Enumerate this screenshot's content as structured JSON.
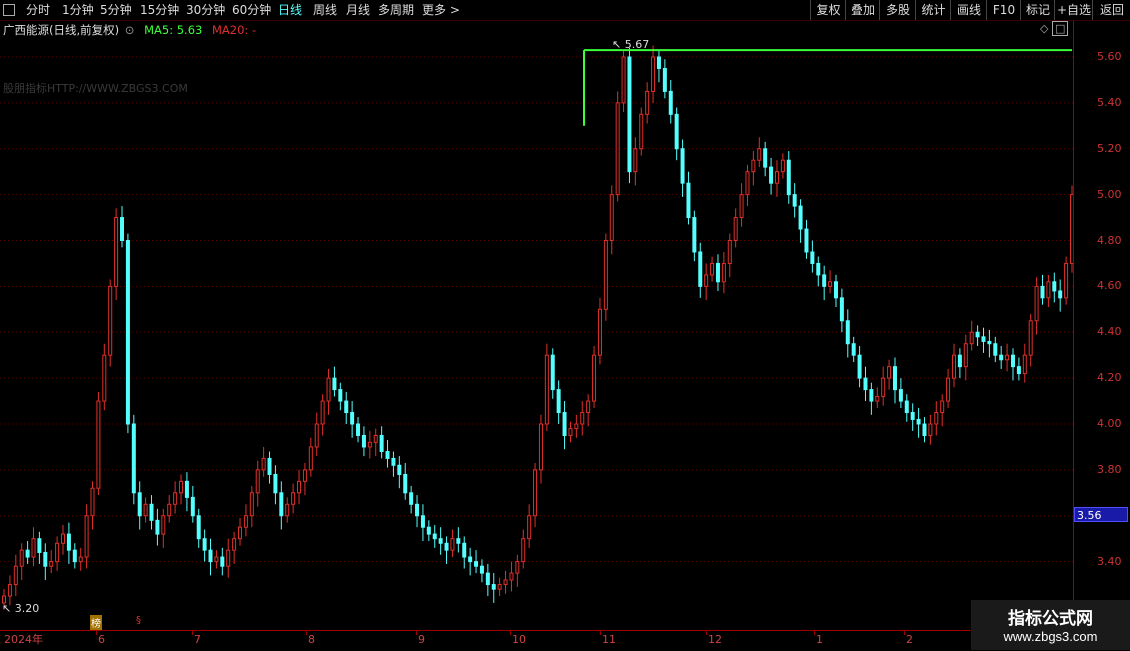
{
  "toolbar": {
    "left_items": [
      "分时",
      "1分钟",
      "5分钟",
      "15分钟",
      "30分钟",
      "60分钟",
      "日线",
      "周线",
      "月线",
      "多周期",
      "更多 >"
    ],
    "active": "日线",
    "right_items": [
      "复权",
      "叠加",
      "多股",
      "统计",
      "画线",
      "F10",
      "标记",
      "+自选",
      "返回"
    ]
  },
  "info": {
    "stock_name": "广西能源(日线,前复权)",
    "ma5_label": "MA5: 5.63",
    "ma20_label": "MA20: -"
  },
  "watermark": "股朋指标HTTP://WWW.ZBGS3.COM",
  "price_axis": {
    "ticks": [
      "5.60",
      "5.40",
      "5.20",
      "5.00",
      "4.80",
      "4.60",
      "4.40",
      "4.20",
      "4.00",
      "3.80",
      "3.40"
    ],
    "current_price": "3.56"
  },
  "annotations": {
    "high": "5.67",
    "low": "3.20"
  },
  "time_axis": {
    "labels": [
      "2024年",
      "6",
      "7",
      "8",
      "9",
      "10",
      "11",
      "12",
      "1",
      "2"
    ]
  },
  "markers": {
    "bang": "榜",
    "s": "§"
  },
  "logo": {
    "title": "指标公式网",
    "url": "www.zbgs3.com"
  },
  "colors": {
    "up": "#e0302a",
    "down": "#54ffff",
    "grid": "#5a0000",
    "highline": "#3cff3c"
  },
  "chart_data": {
    "type": "candlestick",
    "title": "广西能源(日线,前复权)",
    "y_range": [
      3.2,
      5.67
    ],
    "high": 5.67,
    "low": 3.2,
    "last_close": 3.56,
    "closes": [
      3.25,
      3.3,
      3.38,
      3.45,
      3.42,
      3.5,
      3.44,
      3.38,
      3.4,
      3.48,
      3.52,
      3.45,
      3.4,
      3.42,
      3.6,
      3.72,
      4.1,
      4.3,
      4.6,
      4.9,
      4.8,
      4.0,
      3.7,
      3.6,
      3.65,
      3.58,
      3.52,
      3.6,
      3.65,
      3.7,
      3.75,
      3.68,
      3.6,
      3.5,
      3.45,
      3.4,
      3.42,
      3.38,
      3.45,
      3.5,
      3.55,
      3.6,
      3.7,
      3.8,
      3.85,
      3.78,
      3.7,
      3.6,
      3.65,
      3.7,
      3.75,
      3.8,
      3.9,
      4.0,
      4.1,
      4.2,
      4.15,
      4.1,
      4.05,
      4.0,
      3.95,
      3.9,
      3.92,
      3.95,
      3.88,
      3.85,
      3.82,
      3.78,
      3.7,
      3.65,
      3.6,
      3.55,
      3.52,
      3.5,
      3.48,
      3.45,
      3.5,
      3.48,
      3.42,
      3.4,
      3.38,
      3.35,
      3.3,
      3.28,
      3.3,
      3.32,
      3.35,
      3.4,
      3.5,
      3.6,
      3.8,
      4.0,
      4.3,
      4.15,
      4.05,
      3.95,
      3.98,
      4.0,
      4.05,
      4.1,
      4.3,
      4.5,
      4.8,
      5.0,
      5.4,
      5.6,
      5.1,
      5.2,
      5.35,
      5.45,
      5.6,
      5.55,
      5.45,
      5.35,
      5.2,
      5.05,
      4.9,
      4.75,
      4.6,
      4.65,
      4.7,
      4.62,
      4.7,
      4.8,
      4.9,
      5.0,
      5.1,
      5.15,
      5.2,
      5.12,
      5.05,
      5.1,
      5.15,
      5.0,
      4.95,
      4.85,
      4.75,
      4.7,
      4.65,
      4.6,
      4.62,
      4.55,
      4.45,
      4.35,
      4.3,
      4.2,
      4.15,
      4.1,
      4.12,
      4.2,
      4.25,
      4.15,
      4.1,
      4.05,
      4.02,
      4.0,
      3.95,
      4.0,
      4.05,
      4.1,
      4.2,
      4.3,
      4.25,
      4.35,
      4.4,
      4.38,
      4.36,
      4.35,
      4.3,
      4.28,
      4.3,
      4.25,
      4.22,
      4.3,
      4.45,
      4.6,
      4.55,
      4.62,
      4.58,
      4.55,
      4.7,
      5.0
    ]
  }
}
